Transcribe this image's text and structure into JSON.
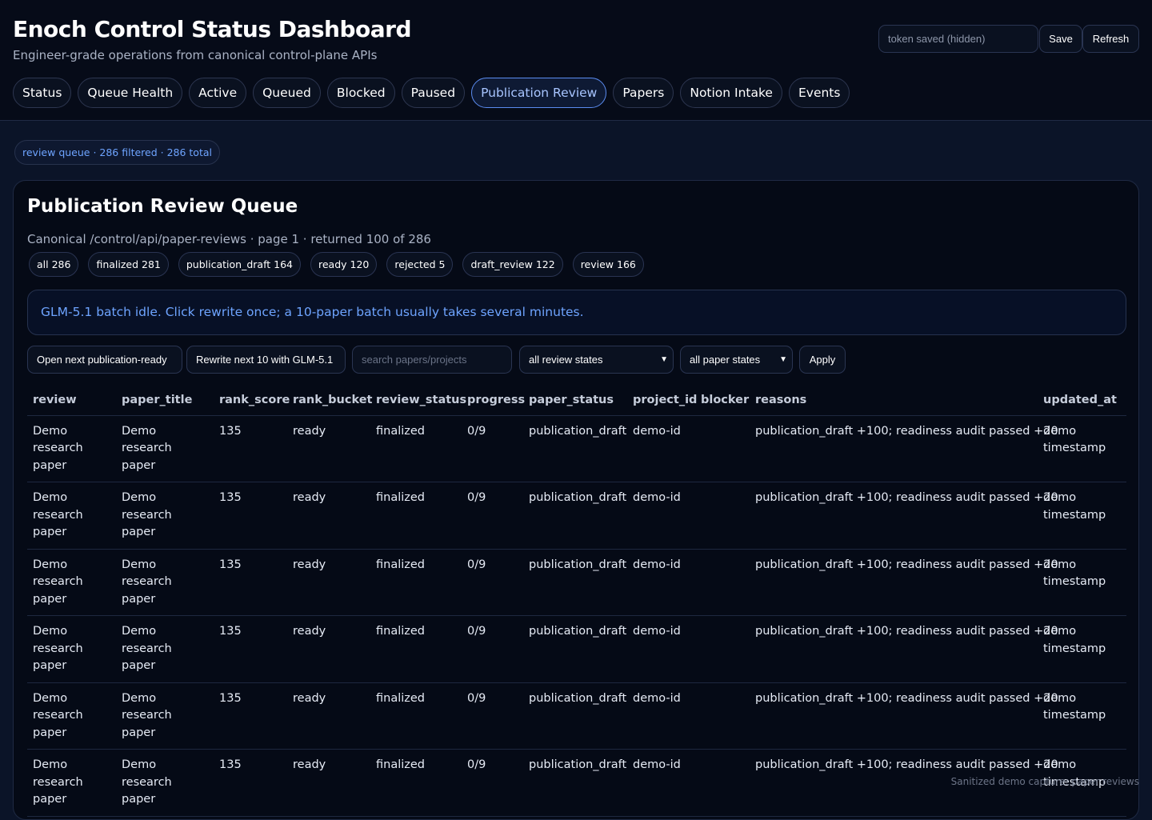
{
  "header": {
    "title": "Enoch Control Status Dashboard",
    "subtitle": "Engineer-grade operations from canonical control-plane APIs",
    "token_placeholder": "token saved (hidden)",
    "save_label": "Save",
    "refresh_label": "Refresh"
  },
  "tabs": [
    {
      "label": "Status"
    },
    {
      "label": "Queue Health"
    },
    {
      "label": "Active"
    },
    {
      "label": "Queued"
    },
    {
      "label": "Blocked"
    },
    {
      "label": "Paused"
    },
    {
      "label": "Publication Review",
      "active": true
    },
    {
      "label": "Papers"
    },
    {
      "label": "Notion Intake"
    },
    {
      "label": "Events"
    }
  ],
  "summary": "review queue · 286 filtered · 286 total",
  "panel": {
    "title": "Publication Review Queue",
    "description": "Canonical /control/api/paper-reviews · page 1 · returned 100 of 286",
    "filters": [
      "all 286",
      "finalized 281",
      "publication_draft 164",
      "ready 120",
      "rejected 5",
      "draft_review 122",
      "review 166"
    ],
    "notice": "GLM-5.1 batch idle. Click rewrite once; a 10-paper batch usually takes several minutes.",
    "controls": {
      "open_next": "Open next publication-ready",
      "rewrite_next": "Rewrite next 10 with GLM-5.1",
      "search_placeholder": "search papers/projects",
      "review_state_selected": "all review states",
      "paper_state_selected": "all paper states",
      "apply": "Apply"
    },
    "table": {
      "columns": [
        "review",
        "paper_title",
        "rank_score",
        "rank_bucket",
        "review_status",
        "progress",
        "paper_status",
        "project_id",
        "blocker",
        "reasons",
        "updated_at"
      ],
      "rows": [
        {
          "review": "Demo research paper",
          "paper_title": "Demo research paper",
          "rank_score": "135",
          "rank_bucket": "ready",
          "review_status": "finalized",
          "progress": "0/9",
          "paper_status": "publication_draft",
          "project_id": "demo-id",
          "blocker": "",
          "reasons": "publication_draft +100; readiness audit passed +20",
          "updated_at": "demo timestamp"
        },
        {
          "review": "Demo research paper",
          "paper_title": "Demo research paper",
          "rank_score": "135",
          "rank_bucket": "ready",
          "review_status": "finalized",
          "progress": "0/9",
          "paper_status": "publication_draft",
          "project_id": "demo-id",
          "blocker": "",
          "reasons": "publication_draft +100; readiness audit passed +20",
          "updated_at": "demo timestamp"
        },
        {
          "review": "Demo research paper",
          "paper_title": "Demo research paper",
          "rank_score": "135",
          "rank_bucket": "ready",
          "review_status": "finalized",
          "progress": "0/9",
          "paper_status": "publication_draft",
          "project_id": "demo-id",
          "blocker": "",
          "reasons": "publication_draft +100; readiness audit passed +20",
          "updated_at": "demo timestamp"
        },
        {
          "review": "Demo research paper",
          "paper_title": "Demo research paper",
          "rank_score": "135",
          "rank_bucket": "ready",
          "review_status": "finalized",
          "progress": "0/9",
          "paper_status": "publication_draft",
          "project_id": "demo-id",
          "blocker": "",
          "reasons": "publication_draft +100; readiness audit passed +20",
          "updated_at": "demo timestamp"
        },
        {
          "review": "Demo research paper",
          "paper_title": "Demo research paper",
          "rank_score": "135",
          "rank_bucket": "ready",
          "review_status": "finalized",
          "progress": "0/9",
          "paper_status": "publication_draft",
          "project_id": "demo-id",
          "blocker": "",
          "reasons": "publication_draft +100; readiness audit passed +20",
          "updated_at": "demo timestamp"
        },
        {
          "review": "Demo research paper",
          "paper_title": "Demo research paper",
          "rank_score": "135",
          "rank_bucket": "ready",
          "review_status": "finalized",
          "progress": "0/9",
          "paper_status": "publication_draft",
          "project_id": "demo-id",
          "blocker": "",
          "reasons": "publication_draft +100; readiness audit passed +20",
          "updated_at": "demo timestamp"
        }
      ]
    }
  },
  "watermark": "Sanitized demo capture: paper reviews",
  "colors": {
    "background": "#0b1428",
    "header": "#060b18",
    "panel": "#050a16",
    "accent": "#6ea4ff",
    "active_tab_border": "#5b8cf0"
  },
  "icons": {
    "select_chevron": "chevron-down-icon"
  }
}
